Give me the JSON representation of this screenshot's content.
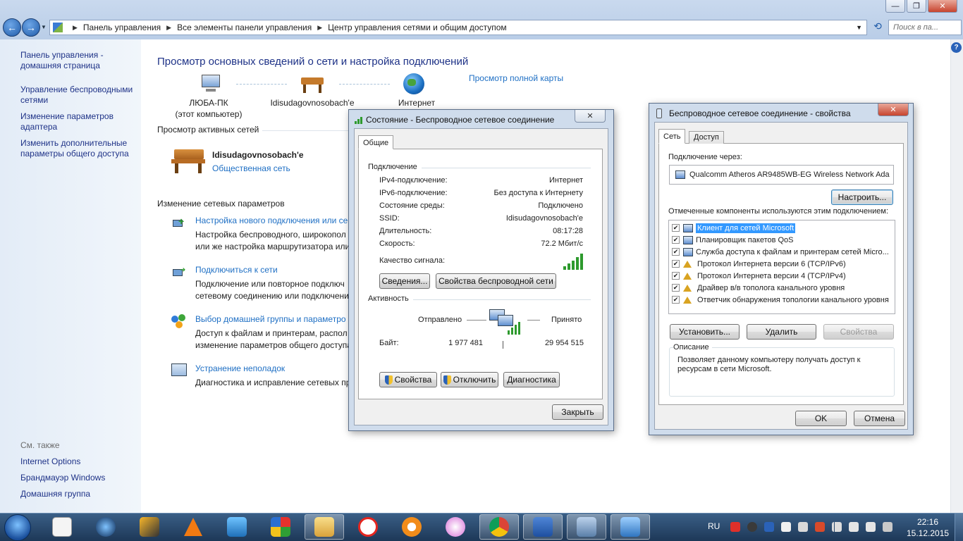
{
  "window": {
    "controls": {
      "minimize": "—",
      "maximize": "❐",
      "close": "✕"
    },
    "nav": {
      "back": "←",
      "forward": "→",
      "recent": "▼"
    },
    "address": [
      "Панель управления",
      "Все элементы панели управления",
      "Центр управления сетями и общим доступом"
    ],
    "search_placeholder": "Поиск в па..."
  },
  "left_pane": {
    "links": [
      "Панель управления - домашняя страница",
      "Управление беспроводными сетями",
      "Изменение параметров адаптера",
      "Изменить дополнительные параметры общего доступа"
    ],
    "see_also_label": "См. также",
    "see_also": [
      "Internet Options",
      "Брандмауэр Windows",
      "Домашняя группа"
    ]
  },
  "main": {
    "title": "Просмотр основных сведений о сети и настройка подключений",
    "map": {
      "computer_name": "ЛЮБА-ПК",
      "computer_sub": "(этот компьютер)",
      "network_name": "Idisudagovnosobach'e",
      "internet": "Интернет",
      "full_map_link": "Просмотр полной карты"
    },
    "active_networks_header": "Просмотр активных сетей",
    "active_network": {
      "name": "Idisudagovnosobach'e",
      "type": "Общественная сеть"
    },
    "change_settings_header": "Изменение сетевых параметров",
    "tasks": [
      {
        "link": "Настройка нового подключения или се",
        "desc1": "Настройка беспроводного, широкопол",
        "desc2": "или же настройка маршрутизатора или"
      },
      {
        "link": "Подключиться к сети",
        "desc1": "Подключение или повторное подключ",
        "desc2": "сетевому соединению или подключени"
      },
      {
        "link": "Выбор домашней группы и параметро",
        "desc1": "Доступ к файлам и принтерам, распол",
        "desc2": "изменение параметров общего доступа"
      },
      {
        "link": "Устранение неполадок",
        "desc1": "Диагностика и исправление сетевых пр",
        "desc2": ""
      }
    ]
  },
  "status_dialog": {
    "title": "Состояние - Беспроводное сетевое соединение",
    "tab": "Общие",
    "connection_group": "Подключение",
    "rows": [
      {
        "k": "IPv4-подключение:",
        "v": "Интернет"
      },
      {
        "k": "IPv6-подключение:",
        "v": "Без доступа к Интернету"
      },
      {
        "k": "Состояние среды:",
        "v": "Подключено"
      },
      {
        "k": "SSID:",
        "v": "Idisudagovnosobach'e"
      },
      {
        "k": "Длительность:",
        "v": "08:17:28"
      },
      {
        "k": "Скорость:",
        "v": "72.2 Мбит/с"
      }
    ],
    "signal_label": "Качество сигнала:",
    "signal_bars": 5,
    "details_button": "Сведения...",
    "wireless_props_button": "Свойства беспроводной сети",
    "activity_group": "Активность",
    "sent_label": "Отправлено",
    "received_label": "Принято",
    "bytes_label": "Байт:",
    "bytes_sent": "1 977 481",
    "bytes_received": "29 954 515",
    "properties_button": "Свойства",
    "disable_button": "Отключить",
    "diagnose_button": "Диагностика",
    "close_button": "Закрыть"
  },
  "props_dialog": {
    "title": "Беспроводное сетевое соединение - свойства",
    "tabs": [
      "Сеть",
      "Доступ"
    ],
    "connect_using_label": "Подключение через:",
    "adapter": "Qualcomm Atheros AR9485WB-EG Wireless Network Ada",
    "configure_button": "Настроить...",
    "components_label": "Отмеченные компоненты используются этим подключением:",
    "components": [
      {
        "label": "Клиент для сетей Microsoft",
        "checked": true,
        "selected": true
      },
      {
        "label": "Планировщик пакетов QoS",
        "checked": true,
        "selected": false
      },
      {
        "label": "Служба доступа к файлам и принтерам сетей Micro...",
        "checked": true,
        "selected": false
      },
      {
        "label": "Протокол Интернета версии 6 (TCP/IPv6)",
        "checked": true,
        "selected": false
      },
      {
        "label": "Протокол Интернета версии 4 (TCP/IPv4)",
        "checked": true,
        "selected": false
      },
      {
        "label": "Драйвер в/в тополога канального уровня",
        "checked": true,
        "selected": false
      },
      {
        "label": "Ответчик обнаружения топологии канального уровня",
        "checked": true,
        "selected": false
      }
    ],
    "install_button": "Установить...",
    "uninstall_button": "Удалить",
    "properties_button": "Свойства",
    "description_group": "Описание",
    "description_line1": "Позволяет данному компьютеру получать доступ к",
    "description_line2": "ресурсам в сети Microsoft.",
    "ok_button": "OK",
    "cancel_button": "Отмена"
  },
  "taskbar": {
    "language": "RU",
    "time": "22:16",
    "date": "15.12.2015",
    "apps": [
      "abc-icon",
      "media-icon",
      "winamp-icon",
      "vlc-icon",
      "music-icon",
      "windows-icon",
      "explorer-icon",
      "yandex-icon",
      "video-icon",
      "itunes-icon",
      "chrome-icon",
      "word-icon",
      "network-icon",
      "control-panel-icon"
    ]
  }
}
